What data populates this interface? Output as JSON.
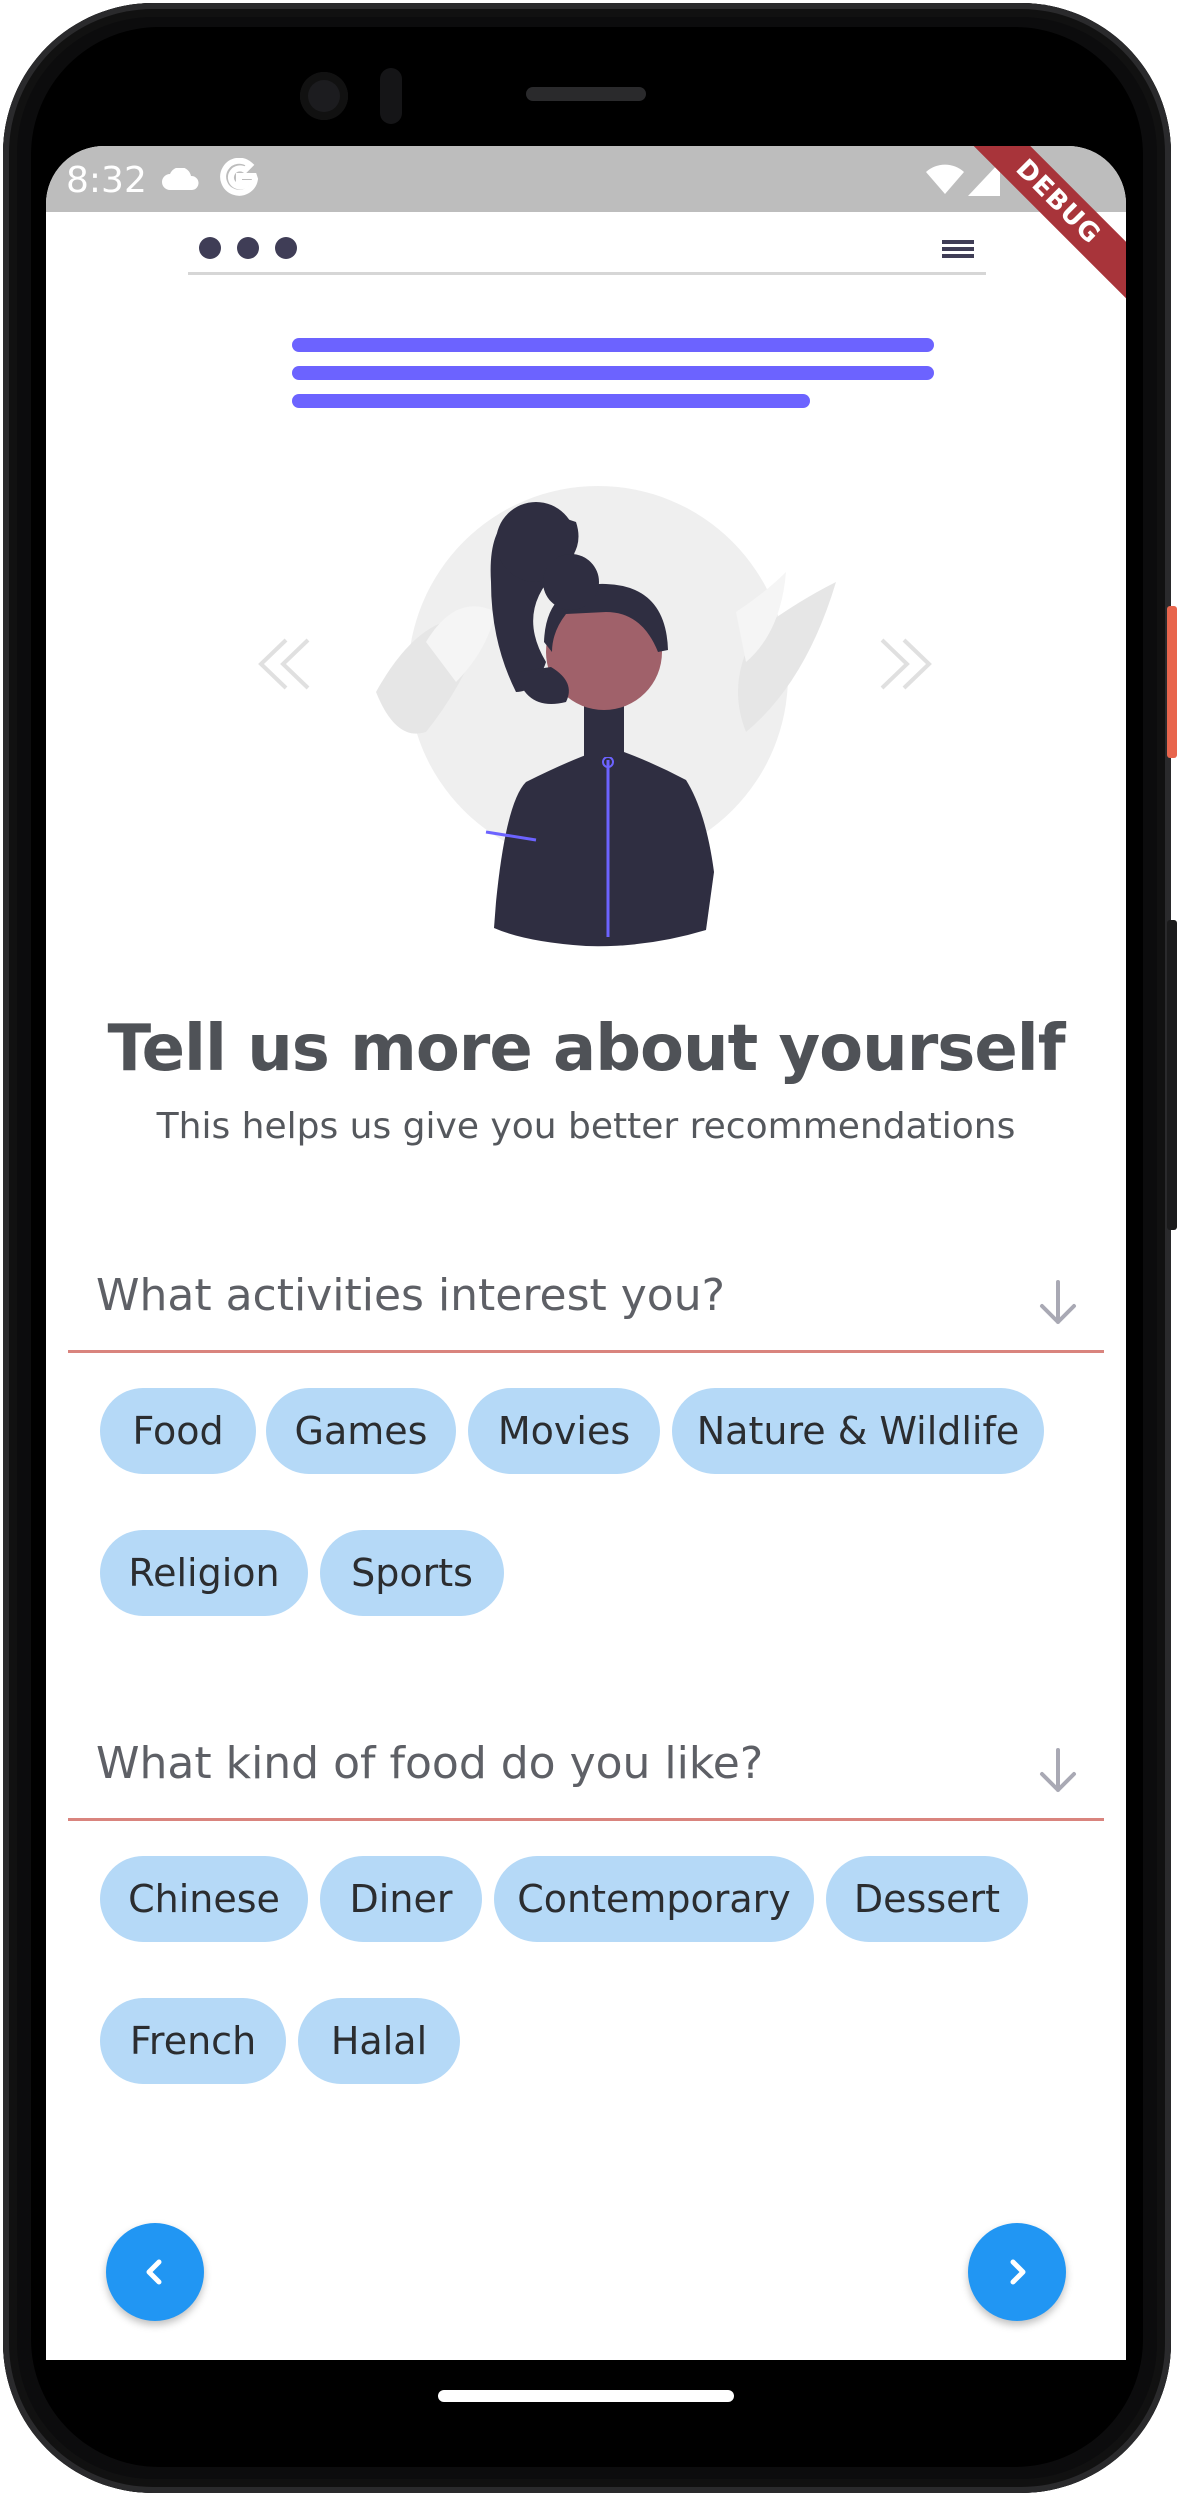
{
  "status_bar": {
    "time": "8:32",
    "icons": [
      "cloud-icon",
      "google-g-icon",
      "wifi-icon",
      "signal-icon",
      "battery-icon"
    ]
  },
  "debug_banner": "DEBUG",
  "colors": {
    "accent": "#6c63ff",
    "chip_bg": "#b5d9f7",
    "nav_button": "#2196f3",
    "divider": "#d9847e",
    "title": "#4f5257"
  },
  "header": {
    "title": "Tell us more about yourself",
    "subtitle": "This helps us give you better recommendations"
  },
  "questions": [
    {
      "label": "What activities interest you?",
      "options": [
        "Food",
        "Games",
        "Movies",
        "Nature & Wildlife",
        "Religion",
        "Sports"
      ]
    },
    {
      "label": "What kind of food do you like?",
      "options": [
        "Chinese",
        "Diner",
        "Contemporary",
        "Dessert",
        "French",
        "Halal"
      ]
    }
  ],
  "navigation": {
    "back_icon": "chevron-left-icon",
    "next_icon": "chevron-right-icon"
  }
}
